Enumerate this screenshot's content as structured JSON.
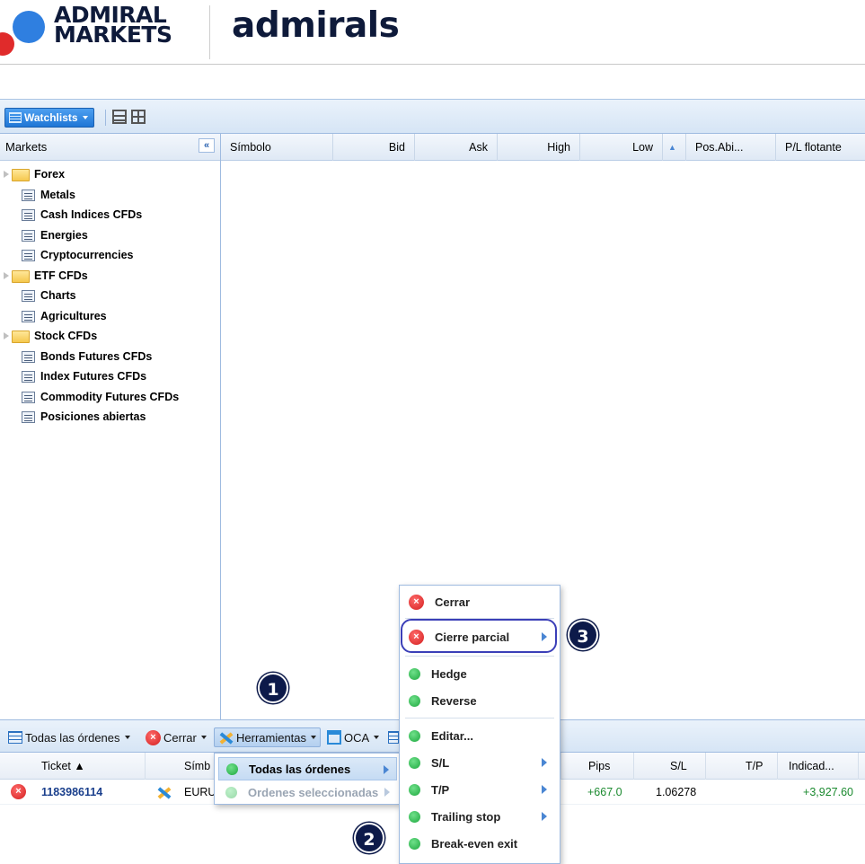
{
  "brand": {
    "logo_line1": "ADMIRAL",
    "logo_line2": "MARKETS",
    "logo2": "admirals",
    "colors": {
      "blue": "#2f7fe0",
      "red": "#e02b2b",
      "navy": "#0e1a3a"
    }
  },
  "toolbar": {
    "watchlists_label": "Watchlists",
    "icons": [
      "list-view-icon",
      "grid-view-icon"
    ]
  },
  "markets": {
    "header": "Markets",
    "collapse_glyph": "«",
    "items": [
      {
        "label": "Forex",
        "type": "folder"
      },
      {
        "label": "Metals",
        "type": "list"
      },
      {
        "label": "Cash Indices CFDs",
        "type": "list"
      },
      {
        "label": "Energies",
        "type": "list"
      },
      {
        "label": "Cryptocurrencies",
        "type": "list"
      },
      {
        "label": "ETF CFDs",
        "type": "folder"
      },
      {
        "label": "Charts",
        "type": "list"
      },
      {
        "label": "Agricultures",
        "type": "list"
      },
      {
        "label": "Stock CFDs",
        "type": "folder"
      },
      {
        "label": "Bonds Futures CFDs",
        "type": "list"
      },
      {
        "label": "Index Futures CFDs",
        "type": "list"
      },
      {
        "label": "Commodity Futures CFDs",
        "type": "list"
      },
      {
        "label": "Posiciones abiertas",
        "type": "list"
      }
    ]
  },
  "grid": {
    "columns": [
      "Símbolo",
      "Bid",
      "Ask",
      "High",
      "Low",
      "▲",
      "Pos.Abi...",
      "P/L flotante"
    ]
  },
  "orders_toolbar": {
    "all_orders": "Todas las órdenes",
    "close": "Cerrar",
    "tools": "Herramientas",
    "oca": "OCA"
  },
  "orders_table": {
    "columns": {
      "ticket": "Ticket ▲",
      "symbol": "Símb",
      "pips": "Pips",
      "sl": "S/L",
      "tp": "T/P",
      "indicator": "Indicad..."
    },
    "rows": [
      {
        "ticket": "1183986114",
        "symbol": "EURU",
        "pips": "+667.0",
        "sl": "1.06278",
        "tp": "",
        "indicator": "+3,927.60"
      }
    ]
  },
  "submenu": {
    "items": [
      {
        "label": "Todas las órdenes",
        "state": "active"
      },
      {
        "label": "Ordenes seleccionadas",
        "state": "disabled"
      }
    ]
  },
  "context_menu": {
    "items": [
      {
        "label": "Cerrar",
        "icon": "close-icon"
      },
      {
        "label": "Cierre parcial",
        "icon": "close-icon",
        "has_submenu": true
      },
      {
        "label": "Hedge",
        "icon": "green-dot-icon"
      },
      {
        "label": "Reverse",
        "icon": "green-dot-icon"
      },
      {
        "label": "Editar...",
        "icon": "green-dot-icon"
      },
      {
        "label": "S/L",
        "icon": "green-dot-icon",
        "has_submenu": true
      },
      {
        "label": "T/P",
        "icon": "green-dot-icon",
        "has_submenu": true
      },
      {
        "label": "Trailing stop",
        "icon": "green-dot-icon",
        "has_submenu": true
      },
      {
        "label": "Break-even exit",
        "icon": "green-dot-icon"
      }
    ]
  },
  "steps": [
    "1",
    "2",
    "3"
  ]
}
